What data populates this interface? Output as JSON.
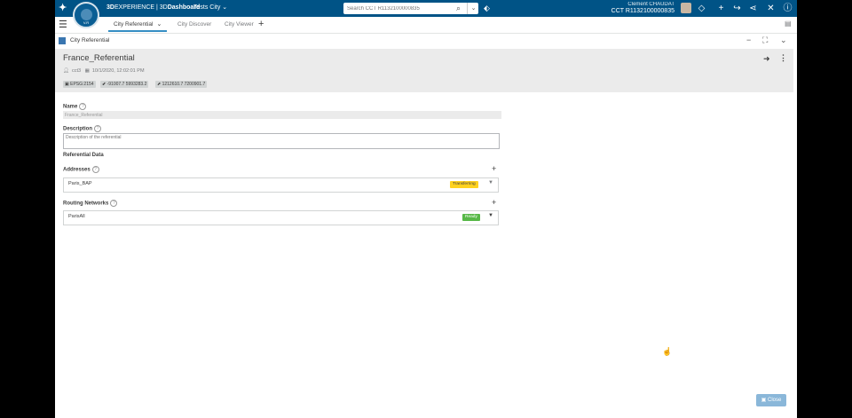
{
  "topbar": {
    "brand_prefix": "3D",
    "brand_middle": "EXPERIENCE | 3D",
    "brand_suffix": "Dashboard",
    "tab_title": "Tests City",
    "compass_label": "V.R",
    "search_placeholder": "Search CCT R1132100000835",
    "user_name": "Clement CHAUDAT",
    "tenant": "CCT R1132100000835"
  },
  "tabs": [
    {
      "label": "City Referential"
    },
    {
      "label": "City Discover"
    },
    {
      "label": "City Viewer"
    }
  ],
  "widget": {
    "title": "City Referential"
  },
  "header": {
    "title": "France_Referential",
    "owner": "cct3",
    "date": "10/1/2020, 12:02:01 PM",
    "chips": [
      "EPSG:2154",
      "-91007.7 5993283.2",
      "1212610.7 7200901.7"
    ]
  },
  "form": {
    "name_label": "Name",
    "name_value": "France_Referential",
    "description_label": "Description",
    "description_placeholder": "Description of the referential",
    "section_title": "Referential Data",
    "addresses_label": "Addresses",
    "addresses": [
      {
        "name": "Paris_BAP",
        "status": "Transferring",
        "status_color": "#ffd21f"
      }
    ],
    "routing_label": "Routing Networks",
    "routing": [
      {
        "name": "ParisAll",
        "status": "Ready",
        "status_color": "#57b847"
      }
    ]
  },
  "footer": {
    "close_label": "Close"
  },
  "colors": {
    "topbar": "#005386",
    "accent": "#368ec4"
  }
}
